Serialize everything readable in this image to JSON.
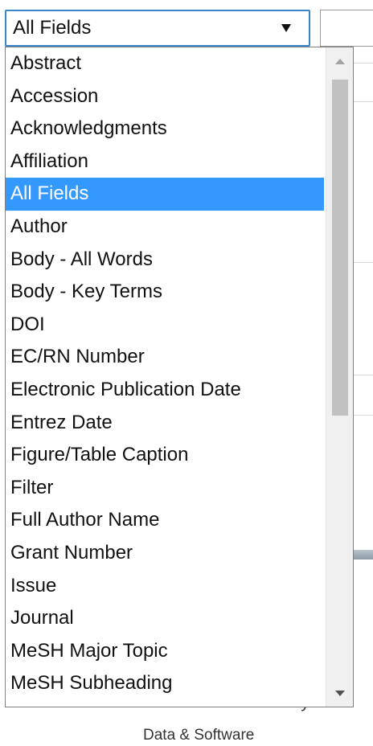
{
  "select": {
    "value": "All Fields"
  },
  "options": [
    {
      "label": "Abstract"
    },
    {
      "label": "Accession"
    },
    {
      "label": "Acknowledgments"
    },
    {
      "label": "Affiliation"
    },
    {
      "label": "All Fields",
      "selected": true
    },
    {
      "label": "Author"
    },
    {
      "label": "Body - All Words"
    },
    {
      "label": "Body - Key Terms"
    },
    {
      "label": "DOI"
    },
    {
      "label": "EC/RN Number"
    },
    {
      "label": "Electronic Publication Date"
    },
    {
      "label": "Entrez Date"
    },
    {
      "label": "Figure/Table Caption"
    },
    {
      "label": "Filter"
    },
    {
      "label": "Full Author Name"
    },
    {
      "label": "Grant Number"
    },
    {
      "label": "Issue"
    },
    {
      "label": "Journal"
    },
    {
      "label": "MeSH Major Topic"
    },
    {
      "label": "MeSH Subheading"
    }
  ],
  "background": {
    "partial_text": "Chemicals & Bioassays",
    "data_software": "Data & Software"
  },
  "colors": {
    "highlight": "#3399ff",
    "select_border": "#3a84c9"
  },
  "icons": {
    "select_arrow": "triangle-down",
    "scroll_up": "triangle-up",
    "scroll_down": "triangle-down"
  }
}
